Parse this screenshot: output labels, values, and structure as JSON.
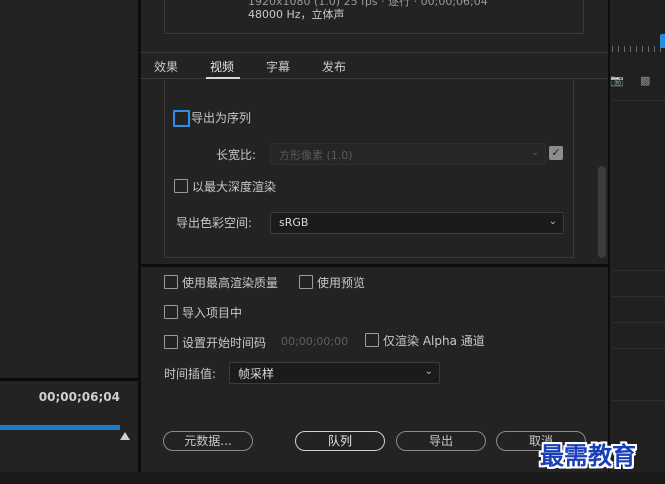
{
  "summary": {
    "line1": "1920x1080 (1.0) 25 fps · 逐行 · 00;00;06;04",
    "line2": "48000 Hz，立体声"
  },
  "tabs": [
    {
      "label": "效果",
      "active": false
    },
    {
      "label": "视频",
      "active": true
    },
    {
      "label": "字幕",
      "active": false
    },
    {
      "label": "发布",
      "active": false
    }
  ],
  "video": {
    "export_as_sequence": "导出为序列",
    "aspect_label": "长宽比:",
    "aspect_value": "方形像素 (1.0)",
    "max_depth": "以最大深度渲染",
    "color_space_label": "导出色彩空间:",
    "color_space_value": "sRGB"
  },
  "options": {
    "max_render_quality": "使用最高渲染质量",
    "use_previews": "使用预览",
    "import_into_project": "导入项目中",
    "set_start_timecode": "设置开始时间码",
    "start_timecode_value": "00;00;00;00",
    "render_alpha_only": "仅渲染 Alpha 通道",
    "time_interpolation_label": "时间插值:",
    "time_interpolation_value": "帧采样"
  },
  "buttons": {
    "metadata": "元数据...",
    "queue": "队列",
    "export": "导出",
    "cancel": "取消"
  },
  "background": {
    "timecode": "00;00;06;04",
    "progress": 1.0
  },
  "watermark": "最需教育",
  "colors": {
    "accent": "#1f78c8",
    "focus": "#2f8fe8",
    "panel": "#232323",
    "watermark": "#1b3fb8"
  }
}
